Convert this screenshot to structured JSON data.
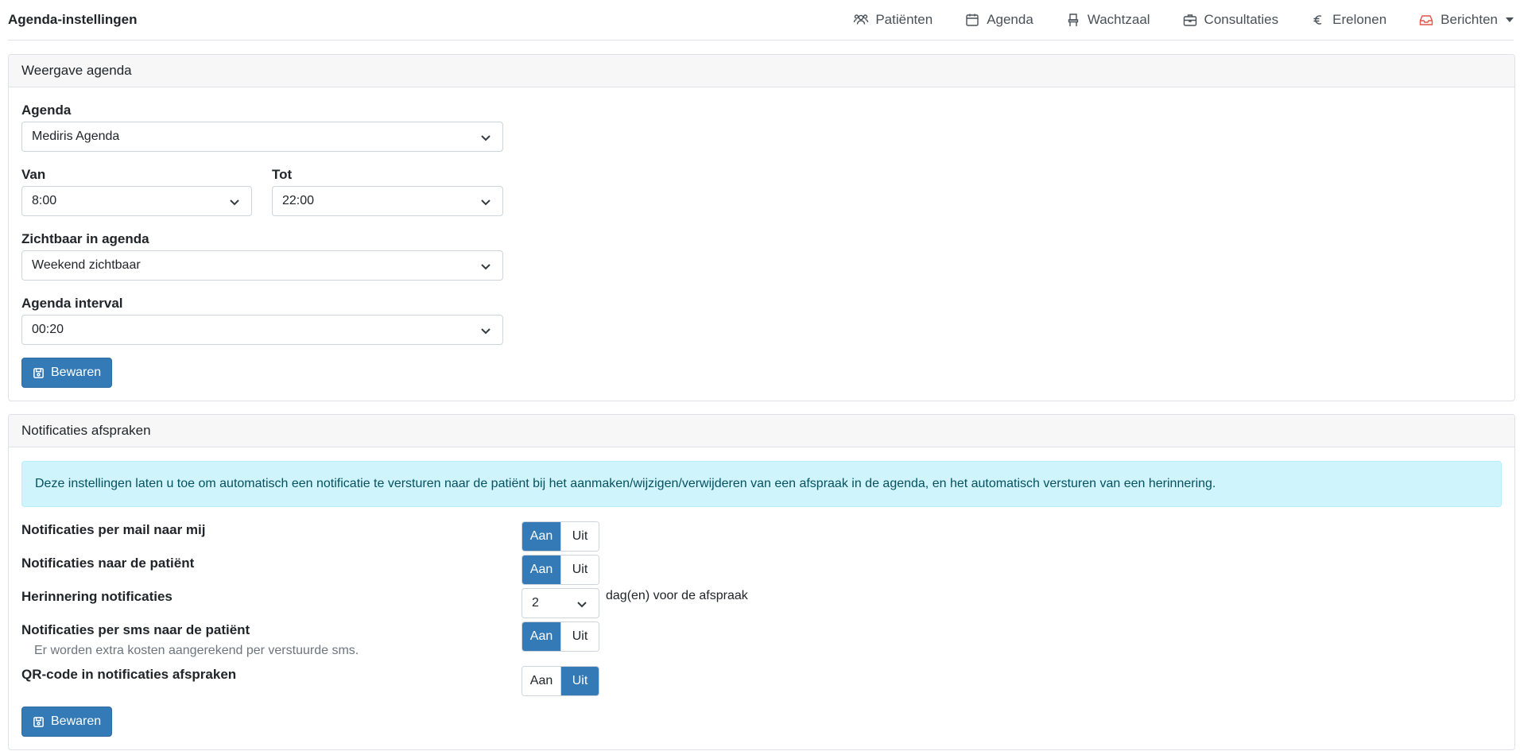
{
  "header": {
    "title": "Agenda-instellingen",
    "nav": [
      {
        "label": "Patiënten",
        "icon": "users-icon"
      },
      {
        "label": "Agenda",
        "icon": "calendar-icon"
      },
      {
        "label": "Wachtzaal",
        "icon": "chair-icon"
      },
      {
        "label": "Consultaties",
        "icon": "briefcase-icon"
      },
      {
        "label": "Erelonen",
        "icon": "euro-icon"
      },
      {
        "label": "Berichten",
        "icon": "inbox-icon"
      }
    ]
  },
  "display_card": {
    "title": "Weergave agenda",
    "agenda_label": "Agenda",
    "agenda_value": "Mediris Agenda",
    "from_label": "Van",
    "from_value": "8:00",
    "to_label": "Tot",
    "to_value": "22:00",
    "visible_label": "Zichtbaar in agenda",
    "visible_value": "Weekend zichtbaar",
    "interval_label": "Agenda interval",
    "interval_value": "00:20",
    "save_label": "Bewaren"
  },
  "notif_card": {
    "title": "Notificaties afspraken",
    "info": "Deze instellingen laten u toe om automatisch een notificatie te versturen naar de patiënt bij het aanmaken/wijzigen/verwijderen van een afspraak in de agenda, en het automatisch versturen van een herinnering.",
    "on_label": "Aan",
    "off_label": "Uit",
    "mail_me_label": "Notificaties per mail naar mij",
    "mail_me_value": "Aan",
    "patient_label": "Notificaties naar de patiënt",
    "patient_value": "Aan",
    "reminder_label": "Herinnering notificaties",
    "reminder_value": "2",
    "reminder_suffix": "dag(en) voor de afspraak",
    "sms_label": "Notificaties per sms naar de patiënt",
    "sms_value": "Aan",
    "sms_hint": "Er worden extra kosten aangerekend per verstuurde sms.",
    "qr_label": "QR-code in notificaties afspraken",
    "qr_value": "Uit",
    "save_label": "Bewaren"
  },
  "colors": {
    "primary": "#337ab7",
    "info_bg": "#cff4fc",
    "info_text": "#055160",
    "messages_icon": "#e05545"
  }
}
